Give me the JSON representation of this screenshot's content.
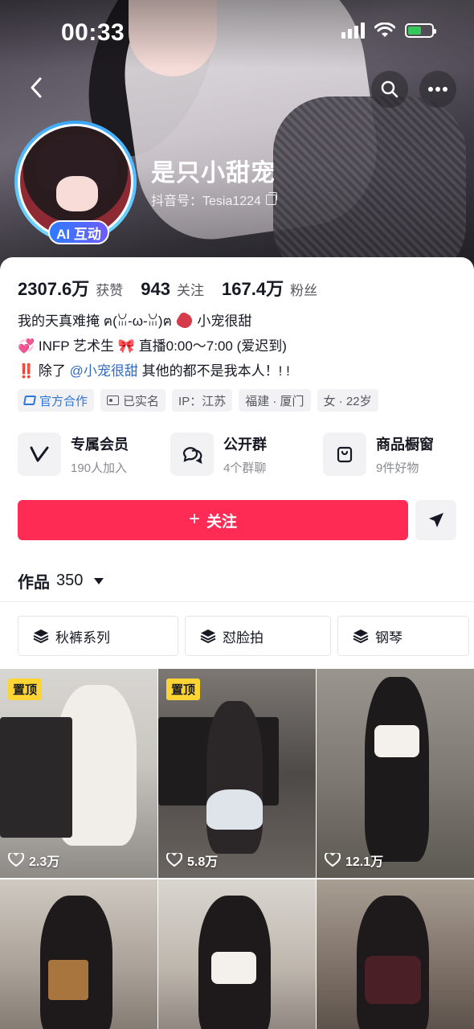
{
  "status_bar": {
    "time": "00:33"
  },
  "profile": {
    "nickname": "是只小甜宠",
    "account_id": "抖音号：Tesia1224",
    "ai_badge": "AI 互动"
  },
  "stats": [
    {
      "num": "2307.6万",
      "label": "获赞"
    },
    {
      "num": "943",
      "label": "关注"
    },
    {
      "num": "167.4万",
      "label": "粉丝"
    }
  ],
  "bio": {
    "line1_text": "我的天真难掩 ฅ(ꈍ-ω-ꈍ)ฅ",
    "line1_tail": "小宠很甜",
    "line2_icon": "💞",
    "line2_text": "INFP 艺术生",
    "line2_bow": "🎀",
    "line2_tail": "直播0:00～7:00 (爱迟到)",
    "line3_exclaim": "‼️",
    "line3_pre": "除了",
    "line3_mention": "@小宠很甜",
    "line3_post": "其他的都不是我本人！! !"
  },
  "tags": {
    "official": "官方合作",
    "verified": "已实名",
    "ip": "IP：江苏",
    "location": "福建 · 厦门",
    "gender_age": "女 · 22岁"
  },
  "features": [
    {
      "title": "专属会员",
      "sub": "190人加入",
      "icon": "membership-v-icon"
    },
    {
      "title": "公开群",
      "sub": "4个群聊",
      "icon": "group-chat-icon"
    },
    {
      "title": "商品橱窗",
      "sub": "9件好物",
      "icon": "shopping-bag-icon"
    }
  ],
  "actions": {
    "follow": "关注"
  },
  "works": {
    "label": "作品",
    "count": "350"
  },
  "collections": [
    "秋裤系列",
    "怼脸拍",
    "钢琴"
  ],
  "videos": [
    {
      "pinned": "置顶",
      "likes": "2.3万"
    },
    {
      "pinned": "置顶",
      "likes": "5.8万"
    },
    {
      "pinned": "",
      "likes": "12.1万"
    },
    {
      "pinned": "",
      "likes": ""
    },
    {
      "pinned": "",
      "likes": ""
    },
    {
      "pinned": "",
      "likes": ""
    }
  ],
  "colors": {
    "accent": "#fe2c55",
    "mention": "#2f6ac3",
    "pin": "#fcd535",
    "ai_badge": "#2f7bff"
  }
}
